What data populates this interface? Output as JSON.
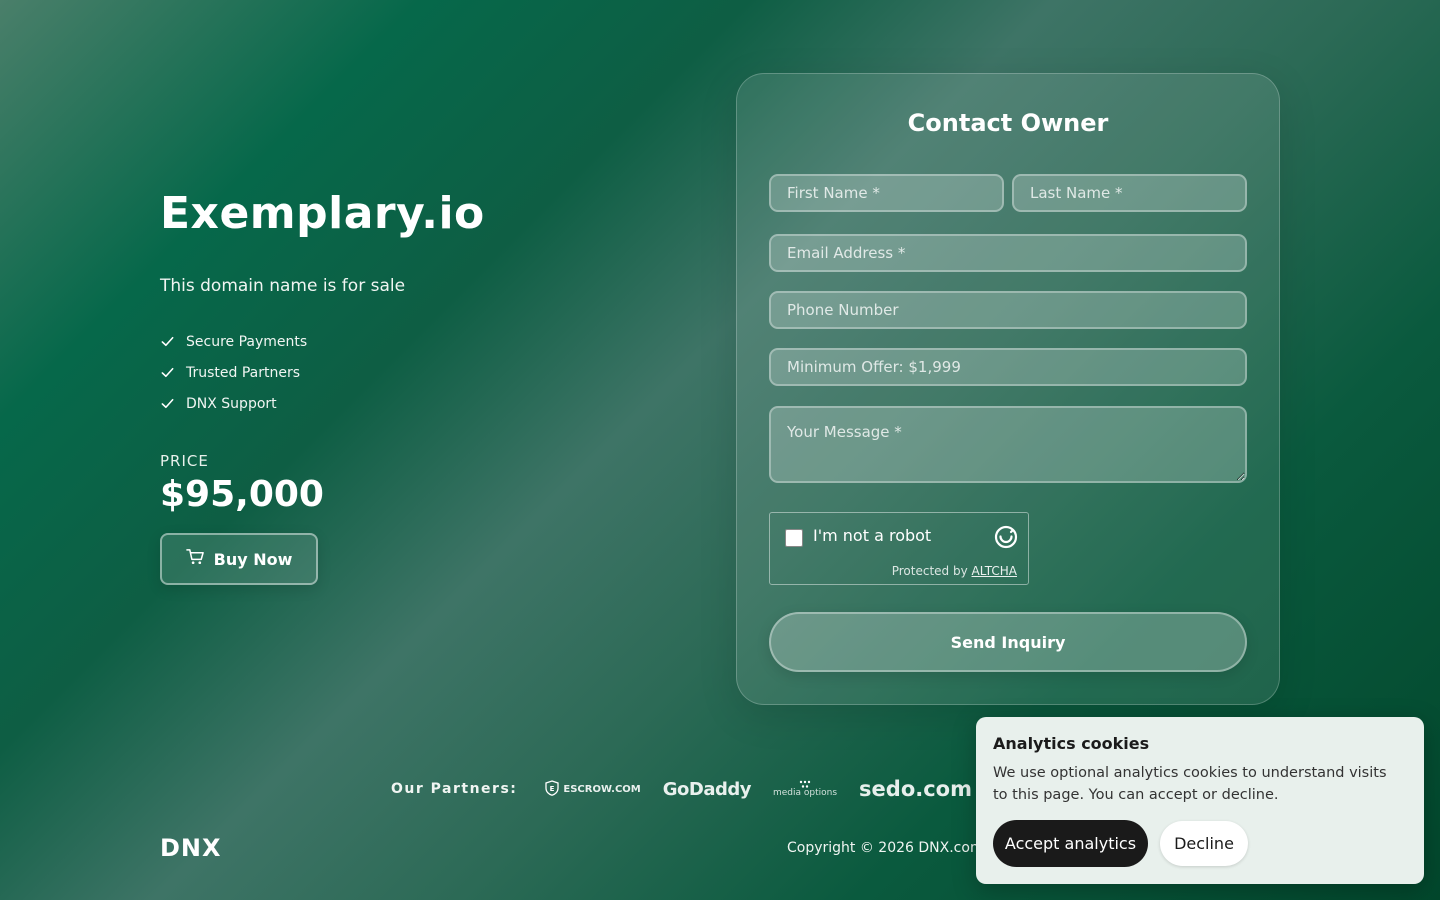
{
  "hero": {
    "domain": "Exemplary.io",
    "subtitle": "This domain name is for sale",
    "features": [
      "Secure Payments",
      "Trusted Partners",
      "DNX Support"
    ],
    "price_label": "PRICE",
    "price": "$95,000",
    "buy_label": "Buy Now"
  },
  "form": {
    "title": "Contact Owner",
    "first_name_placeholder": "First Name *",
    "last_name_placeholder": "Last Name *",
    "email_placeholder": "Email Address *",
    "phone_placeholder": "Phone Number",
    "offer_placeholder": "Minimum Offer: $1,999",
    "message_placeholder": "Your Message *",
    "captcha_label": "I'm not a robot",
    "captcha_protected": "Protected by",
    "captcha_provider": "ALTCHA",
    "submit_label": "Send Inquiry"
  },
  "footer": {
    "partners_label": "Our Partners:",
    "partners": [
      "ESCROW.COM",
      "GoDaddy",
      "media options",
      "sedo.com"
    ],
    "logo": "DNX",
    "copyright": "Copyright © 2026 DNX.com"
  },
  "cookie_banner": {
    "title": "Analytics cookies",
    "text": "We use optional analytics cookies to understand visits to this page. You can accept or decline.",
    "accept_label": "Accept analytics",
    "decline_label": "Decline"
  },
  "icons": [
    "check-icon",
    "cart-icon",
    "altcha-icon",
    "escrow-shield-icon",
    "partner-badge-icon"
  ],
  "colors": {
    "background_primary": "#06684a",
    "background_dark": "#02472c",
    "cookie_background": "#e8f0ec",
    "accept_button": "#1a1a1a"
  }
}
